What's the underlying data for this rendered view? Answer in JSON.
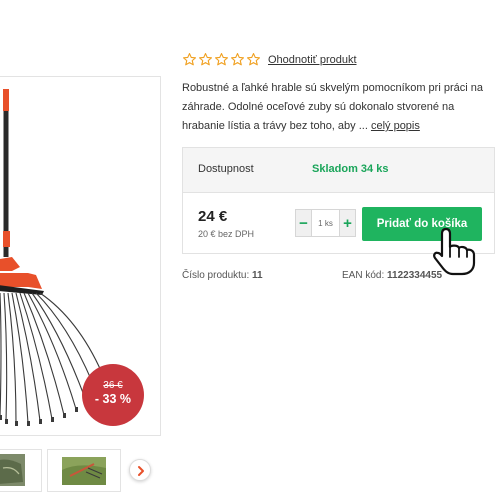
{
  "product": {
    "rating_link": "Ohodnotiť produkt",
    "description": "Robustné a ľahké hrable sú skvelým pomocníkom pri práci na záhrade. Odolné oceľové zuby sú dokonalo stvorené na hrabanie lístia a trávy bez toho, aby ...",
    "full_description_link": "celý popis",
    "stars": 5
  },
  "availability": {
    "label": "Dostupnost",
    "value": "Skladom 34 ks"
  },
  "pricing": {
    "price": "24 €",
    "price_without_vat": "20 € bez DPH",
    "old_price": "36 €",
    "discount": "- 33 %"
  },
  "quantity": {
    "minus": "−",
    "plus": "+",
    "value": "1 ks"
  },
  "cart": {
    "add_label": "Pridať do košíka"
  },
  "meta": {
    "product_number_label": "Číslo produktu:",
    "product_number": "11",
    "ean_label": "EAN kód:",
    "ean": "1122334455"
  },
  "icons": {
    "star": "star-outline-icon",
    "next": "chevron-right-icon",
    "cursor": "hand-pointer-icon"
  },
  "colors": {
    "accent_green": "#1fb45f",
    "availability_green": "#1aa55a",
    "discount_red": "#c8373d",
    "star_orange": "#f0a020",
    "rake_orange": "#e8502a"
  }
}
